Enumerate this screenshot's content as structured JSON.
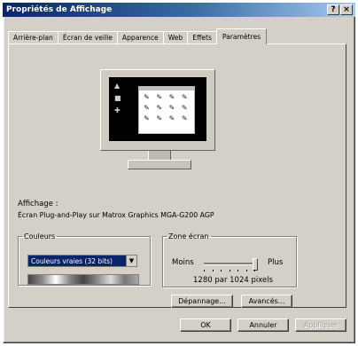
{
  "window": {
    "title": "Propriétés de Affichage",
    "help_glyph": "?",
    "close_glyph": "×"
  },
  "tabs": [
    {
      "label": "Arrière-plan"
    },
    {
      "label": "Écran de veille"
    },
    {
      "label": "Apparence"
    },
    {
      "label": "Web"
    },
    {
      "label": "Effets"
    },
    {
      "label": "Paramètres",
      "active": true
    }
  ],
  "display": {
    "label": "Affichage :",
    "value": "Écran Plug-and-Play sur Matrox Graphics MGA-G200 AGP"
  },
  "colors": {
    "legend": "Couleurs",
    "selected": "Couleurs vraies (32 bits)"
  },
  "screen_area": {
    "legend": "Zone écran",
    "min_label": "Moins",
    "max_label": "Plus",
    "value_text": "1280 par 1024 pixels",
    "slider_level": 1.0
  },
  "buttons": {
    "troubleshoot": "Dépannage...",
    "advanced": "Avancés...",
    "ok": "OK",
    "cancel": "Annuler",
    "apply": "Appliquer"
  }
}
